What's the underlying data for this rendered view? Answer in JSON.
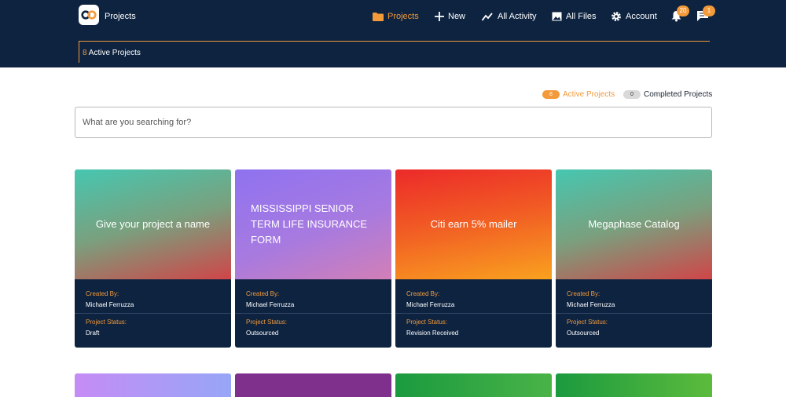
{
  "header": {
    "app_title": "Projects",
    "nav": {
      "projects": "Projects",
      "new": "New",
      "activity": "All Activity",
      "files": "All Files",
      "account": "Account"
    },
    "notifications_count": "20",
    "messages_count": "1",
    "active_count": "8",
    "active_label": "Active Projects"
  },
  "filters": {
    "active": {
      "count": "8",
      "label": "Active Projects"
    },
    "completed": {
      "count": "0",
      "label": "Completed Projects"
    }
  },
  "search": {
    "placeholder": "What are you searching for?"
  },
  "card_labels": {
    "created_by": "Created By:",
    "status": "Project Status:"
  },
  "projects": [
    {
      "title": "Give your project a name",
      "created_by": "Michael Ferruzza",
      "status": "Draft"
    },
    {
      "title": "MISSISSIPPI SENIOR TERM LIFE INSURANCE FORM",
      "created_by": "Michael Ferruzza",
      "status": "Outsourced"
    },
    {
      "title": "Citi earn 5% mailer",
      "created_by": "Michael Ferruzza",
      "status": "Revision Received"
    },
    {
      "title": "Megaphase Catalog",
      "created_by": "Michael Ferruzza",
      "status": "Outsourced"
    }
  ],
  "colors": {
    "header_bg": "#0d2340",
    "accent": "#f39a3a"
  }
}
